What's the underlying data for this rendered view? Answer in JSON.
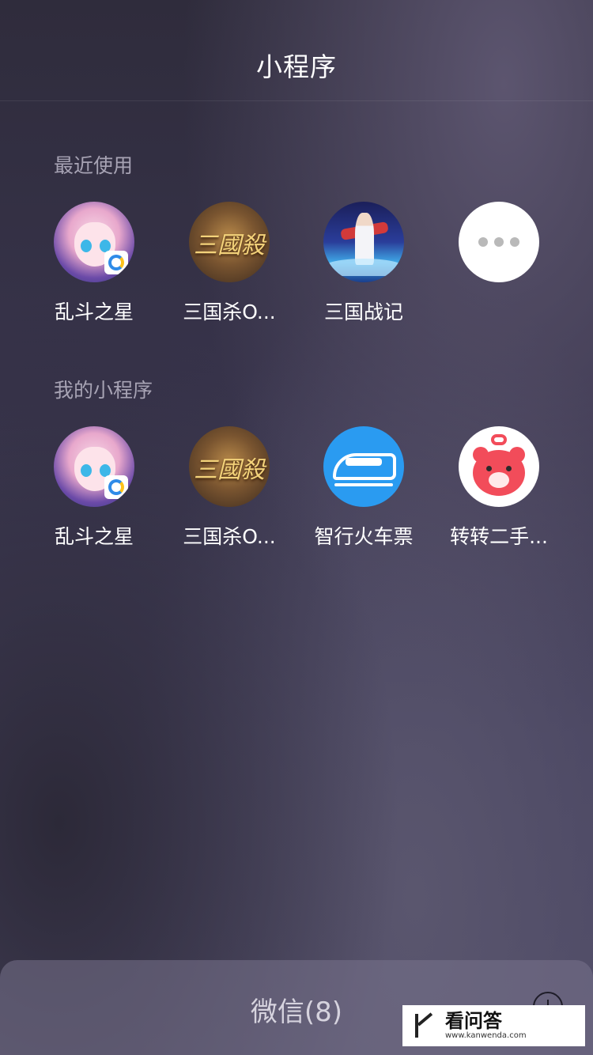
{
  "header": {
    "title": "小程序"
  },
  "recent": {
    "label": "最近使用",
    "items": [
      {
        "label": "乱斗之星",
        "icon": "luandou-star-icon"
      },
      {
        "label": "三国杀O...",
        "icon": "sanguosha-icon",
        "brand": "三國殺"
      },
      {
        "label": "三国战记",
        "icon": "sanguo-zhanji-icon"
      },
      {
        "label": "",
        "icon": "more-icon"
      }
    ]
  },
  "mine": {
    "label": "我的小程序",
    "items": [
      {
        "label": "乱斗之星",
        "icon": "luandou-star-icon"
      },
      {
        "label": "三国杀O...",
        "icon": "sanguosha-icon",
        "brand": "三國殺"
      },
      {
        "label": "智行火车票",
        "icon": "train-icon"
      },
      {
        "label": "转转二手...",
        "icon": "zhuanzhuan-bear-icon"
      }
    ]
  },
  "bottom": {
    "title": "微信(8)",
    "add_icon": "plus-circle-icon"
  },
  "watermark": {
    "brand_cn": "看问答",
    "url": "www.kanwenda.com"
  },
  "colors": {
    "train_blue": "#2a9bf1",
    "zhuanzhuan_red": "#f24c5a"
  }
}
